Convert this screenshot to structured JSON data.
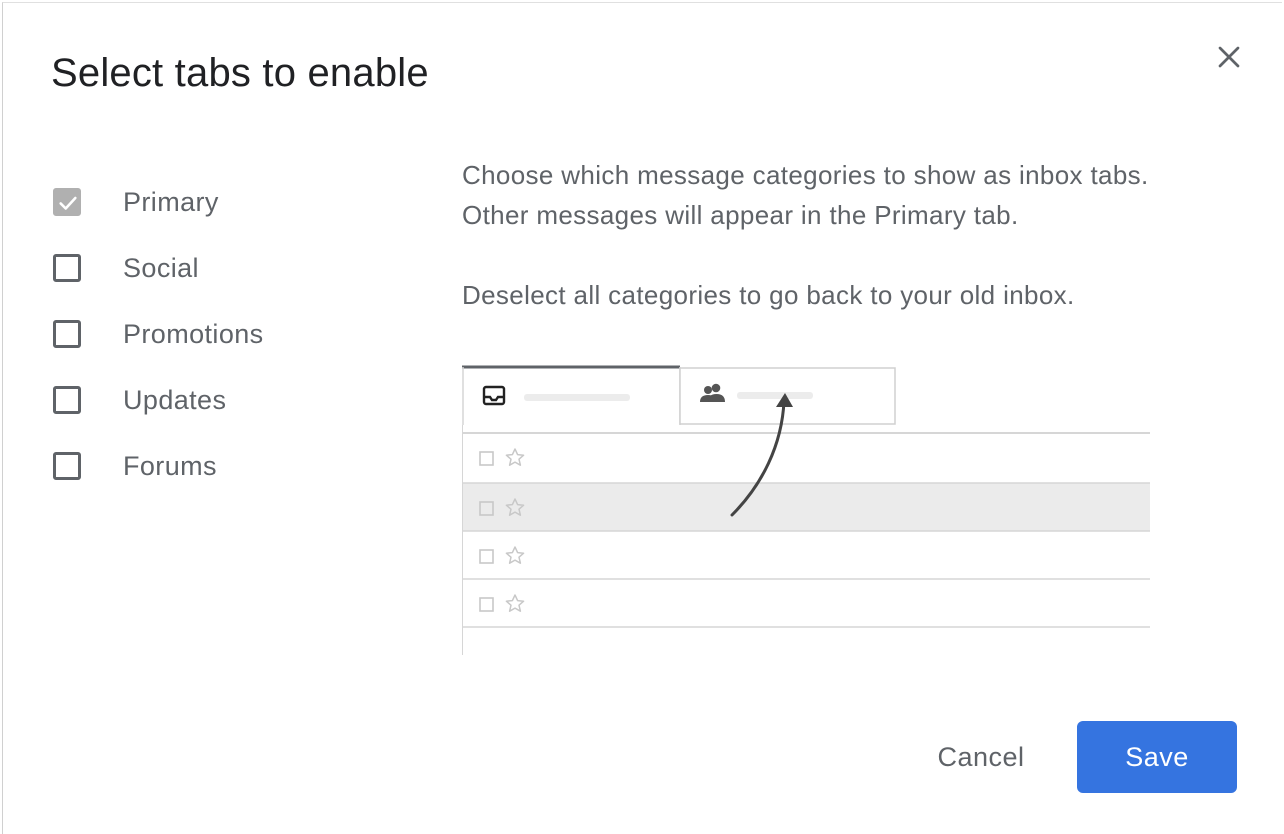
{
  "dialog": {
    "title": "Select tabs to enable",
    "close_icon": "close-icon"
  },
  "options": [
    {
      "label": "Primary",
      "checked": true,
      "disabled": true
    },
    {
      "label": "Social",
      "checked": false,
      "disabled": false
    },
    {
      "label": "Promotions",
      "checked": false,
      "disabled": false
    },
    {
      "label": "Updates",
      "checked": false,
      "disabled": false
    },
    {
      "label": "Forums",
      "checked": false,
      "disabled": false
    }
  ],
  "description": {
    "line1": "Choose which message categories to show as inbox tabs. Other messages will appear in the Primary tab.",
    "line2": "Deselect all categories to go back to your old inbox."
  },
  "illustration": {
    "tab_icons": [
      "inbox-icon",
      "people-icon"
    ],
    "row_icons": [
      "checkbox-icon",
      "star-icon"
    ]
  },
  "actions": {
    "cancel_label": "Cancel",
    "save_label": "Save"
  },
  "colors": {
    "accent": "#3574e0",
    "text_secondary": "#5f6368",
    "title": "#202124"
  }
}
